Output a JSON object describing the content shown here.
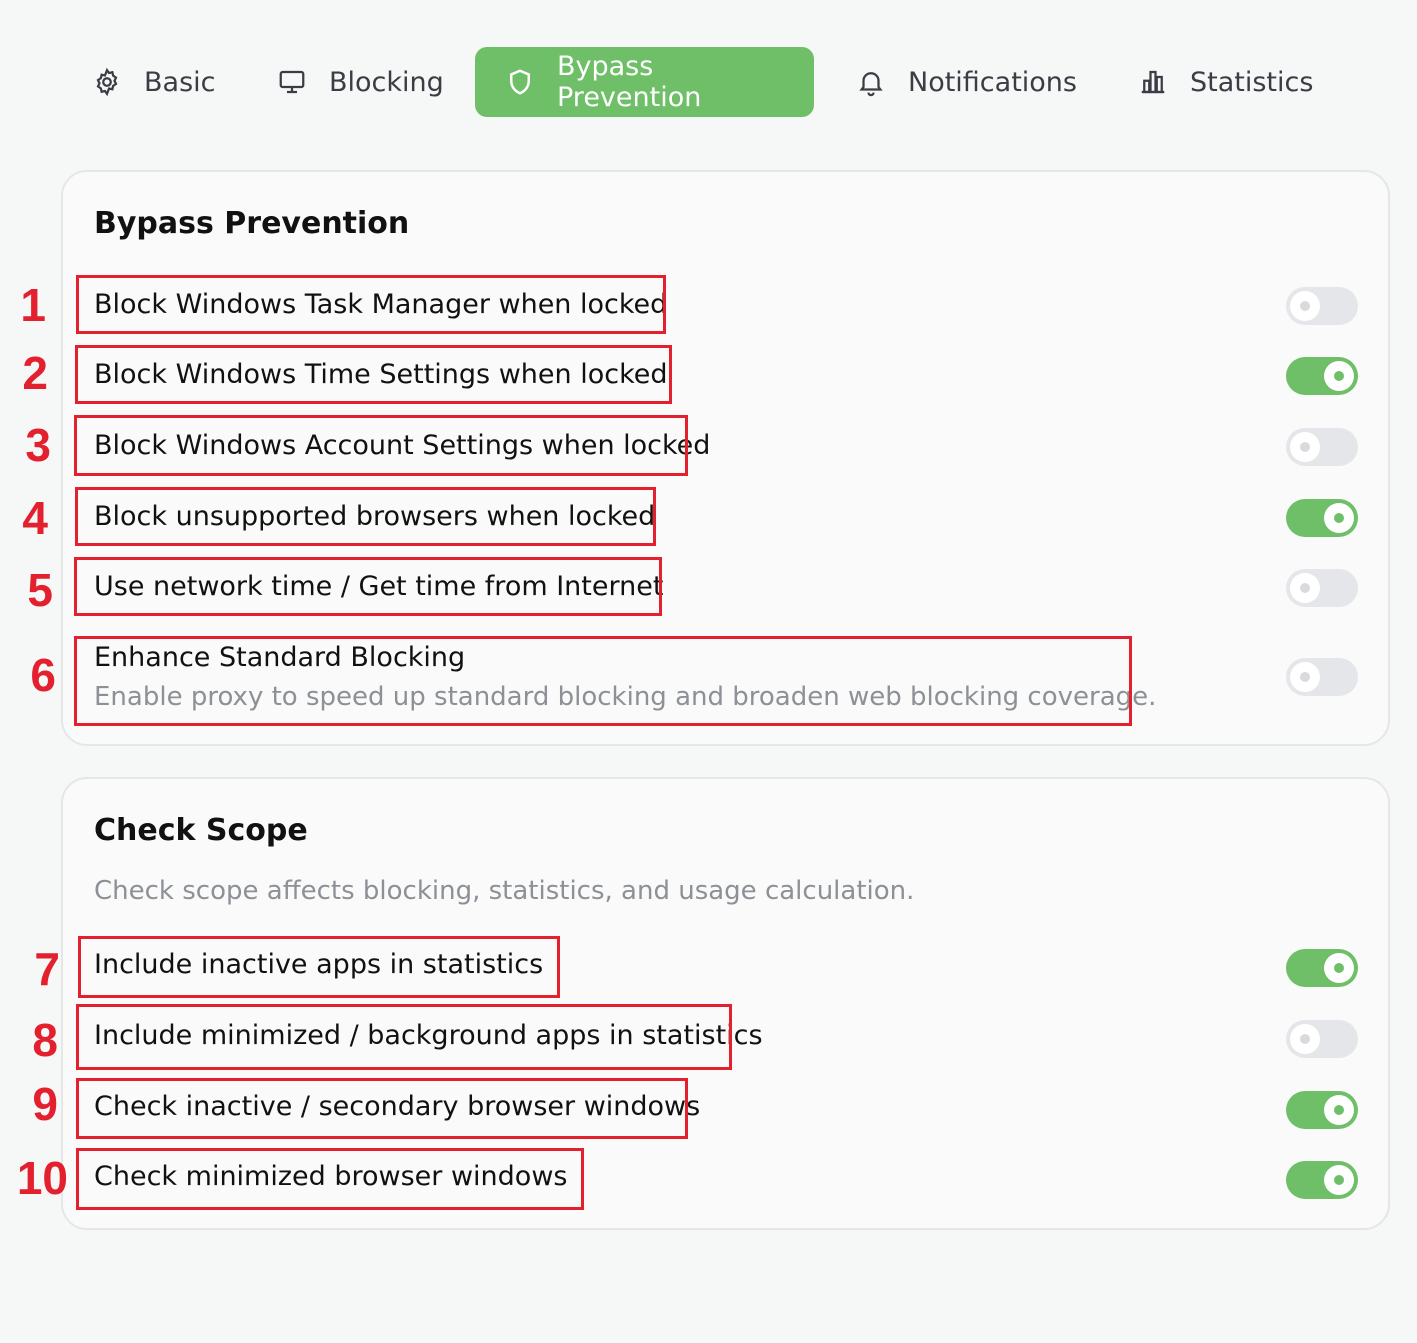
{
  "tabs": [
    {
      "label": "Basic",
      "icon": "gear-icon"
    },
    {
      "label": "Blocking",
      "icon": "monitor-icon"
    },
    {
      "label": "Bypass Prevention",
      "icon": "shield-icon",
      "active": true
    },
    {
      "label": "Notifications",
      "icon": "bell-icon"
    },
    {
      "label": "Statistics",
      "icon": "bar-chart-icon"
    }
  ],
  "colors": {
    "accent": "#6ebf67",
    "highlight": "#e3202e",
    "muted_text": "#8d9197"
  },
  "bypass": {
    "title": "Bypass Prevention",
    "items": [
      {
        "number": "1",
        "label": "Block Windows Task Manager when locked",
        "enabled": false
      },
      {
        "number": "2",
        "label": "Block Windows Time Settings when locked",
        "enabled": true
      },
      {
        "number": "3",
        "label": "Block Windows Account Settings when locked",
        "enabled": false
      },
      {
        "number": "4",
        "label": "Block unsupported browsers when locked",
        "enabled": true
      },
      {
        "number": "5",
        "label": "Use network time / Get time from Internet",
        "enabled": false
      },
      {
        "number": "6",
        "label": "Enhance Standard Blocking",
        "description": "Enable proxy to speed up standard blocking and broaden web blocking coverage.",
        "enabled": false
      }
    ]
  },
  "scope": {
    "title": "Check Scope",
    "description": "Check scope affects blocking, statistics, and usage calculation.",
    "items": [
      {
        "number": "7",
        "label": "Include inactive apps in statistics",
        "enabled": true
      },
      {
        "number": "8",
        "label": "Include minimized / background apps in statistics",
        "enabled": false
      },
      {
        "number": "9",
        "label": "Check inactive / secondary browser windows",
        "enabled": true
      },
      {
        "number": "10",
        "label": "Check minimized browser windows",
        "enabled": true
      }
    ]
  }
}
